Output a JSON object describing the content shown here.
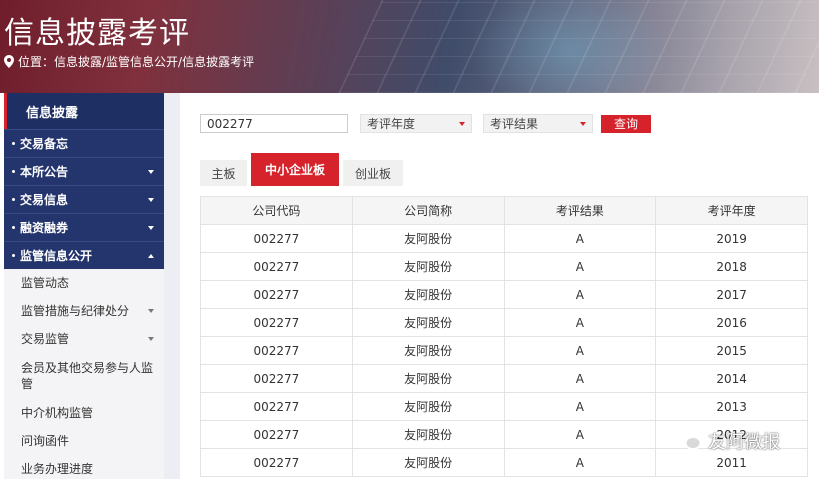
{
  "banner": {
    "title": "信息披露考评",
    "breadcrumb": "位置：信息披露/监管信息公开/信息披露考评"
  },
  "sidebar": {
    "header": "信息披露",
    "items": [
      {
        "label": "交易备忘",
        "caret": "none"
      },
      {
        "label": "本所公告",
        "caret": "down"
      },
      {
        "label": "交易信息",
        "caret": "down"
      },
      {
        "label": "融资融券",
        "caret": "down"
      },
      {
        "label": "监管信息公开",
        "caret": "up"
      }
    ],
    "sub_items": [
      {
        "label": "监管动态",
        "caret": false
      },
      {
        "label": "监管措施与纪律处分",
        "caret": true
      },
      {
        "label": "交易监管",
        "caret": true
      },
      {
        "label": "会员及其他交易参与人监管",
        "caret": false
      },
      {
        "label": "中介机构监管",
        "caret": false
      },
      {
        "label": "问询函件",
        "caret": false
      },
      {
        "label": "业务办理进度",
        "caret": false
      }
    ]
  },
  "filters": {
    "code_value": "002277",
    "year_select": "考评年度",
    "result_select": "考评结果",
    "query_button": "查询"
  },
  "tabs": [
    "主板",
    "中小企业板",
    "创业板"
  ],
  "table": {
    "columns": [
      "公司代码",
      "公司简称",
      "考评结果",
      "考评年度"
    ],
    "rows": [
      [
        "002277",
        "友阿股份",
        "A",
        "2019"
      ],
      [
        "002277",
        "友阿股份",
        "A",
        "2018"
      ],
      [
        "002277",
        "友阿股份",
        "A",
        "2017"
      ],
      [
        "002277",
        "友阿股份",
        "A",
        "2016"
      ],
      [
        "002277",
        "友阿股份",
        "A",
        "2015"
      ],
      [
        "002277",
        "友阿股份",
        "A",
        "2014"
      ],
      [
        "002277",
        "友阿股份",
        "A",
        "2013"
      ],
      [
        "002277",
        "友阿股份",
        "A",
        "2012"
      ],
      [
        "002277",
        "友阿股份",
        "A",
        "2011"
      ]
    ]
  },
  "watermark": {
    "text": "友阿微报",
    "icon": "wechat-icon"
  },
  "colors": {
    "accent": "#d5222b",
    "sidebar_navy": "#24356d"
  }
}
